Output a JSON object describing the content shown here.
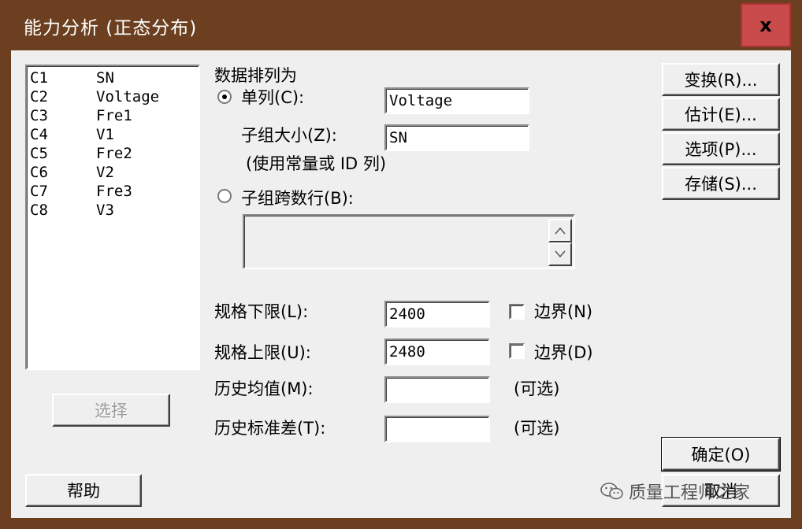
{
  "window": {
    "title": "能力分析 (正态分布)",
    "close_label": "x"
  },
  "columns": [
    {
      "id": "C1",
      "name": "SN"
    },
    {
      "id": "C2",
      "name": "Voltage"
    },
    {
      "id": "C3",
      "name": "Fre1"
    },
    {
      "id": "C4",
      "name": "V1"
    },
    {
      "id": "C5",
      "name": "Fre2"
    },
    {
      "id": "C6",
      "name": "V2"
    },
    {
      "id": "C7",
      "name": "Fre3"
    },
    {
      "id": "C8",
      "name": "V3"
    }
  ],
  "buttons": {
    "select": "选择",
    "help": "帮助",
    "transform": "变换(R)...",
    "estimate": "估计(E)...",
    "options": "选项(P)...",
    "storage": "存储(S)...",
    "ok": "确定(O)",
    "cancel": "取消"
  },
  "data_arrangement": {
    "heading": "数据排列为",
    "single_column_label": "单列(C):",
    "single_column_value": "Voltage",
    "subgroup_size_label": "子组大小(Z):",
    "subgroup_size_value": "SN",
    "subgroup_hint": "(使用常量或 ID 列)",
    "across_rows_label": "子组跨数行(B):",
    "selected": "single_column"
  },
  "spec": {
    "lower_label": "规格下限(L):",
    "lower_value": "2400",
    "lower_bound_label": "边界(N)",
    "upper_label": "规格上限(U):",
    "upper_value": "2480",
    "upper_bound_label": "边界(D)"
  },
  "history": {
    "mean_label": "历史均值(M):",
    "mean_value": "",
    "mean_optional": "(可选)",
    "stdev_label": "历史标准差(T):",
    "stdev_value": "",
    "stdev_optional": "(可选)"
  },
  "watermark": {
    "text": "质量工程师之家"
  },
  "colors": {
    "title_bar": "#6b3f1f",
    "close_button": "#c84a4a",
    "dialog_bg": "#efefef"
  }
}
